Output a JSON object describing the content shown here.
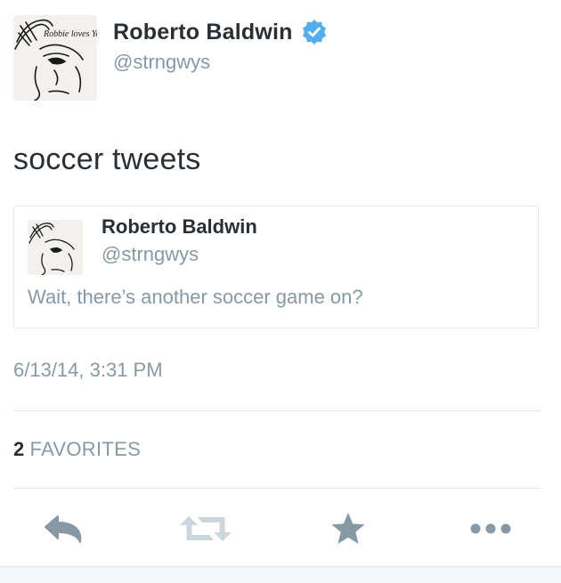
{
  "author": {
    "name": "Roberto Baldwin",
    "handle": "@strngwys",
    "avatar_scribble": "Robbie loves You!!",
    "verified": true
  },
  "tweet": {
    "text": "soccer tweets"
  },
  "quoted_tweet": {
    "name": "Roberto Baldwin",
    "handle": "@strngwys",
    "text": "Wait, there’s another soccer game on?"
  },
  "timestamp": "6/13/14, 3:31 PM",
  "stats": {
    "favorites_count": "2",
    "favorites_label": "FAVORITES"
  },
  "actions": [
    {
      "name": "reply",
      "icon": "reply-icon"
    },
    {
      "name": "retweet",
      "icon": "retweet-icon"
    },
    {
      "name": "favorite",
      "icon": "star-icon"
    },
    {
      "name": "more",
      "icon": "more-icon"
    }
  ],
  "colors": {
    "text_primary": "#292f33",
    "text_secondary": "#8899a6",
    "verified_blue": "#55acee",
    "action_icon": "#8899a6",
    "divider": "#e1e8ed"
  }
}
